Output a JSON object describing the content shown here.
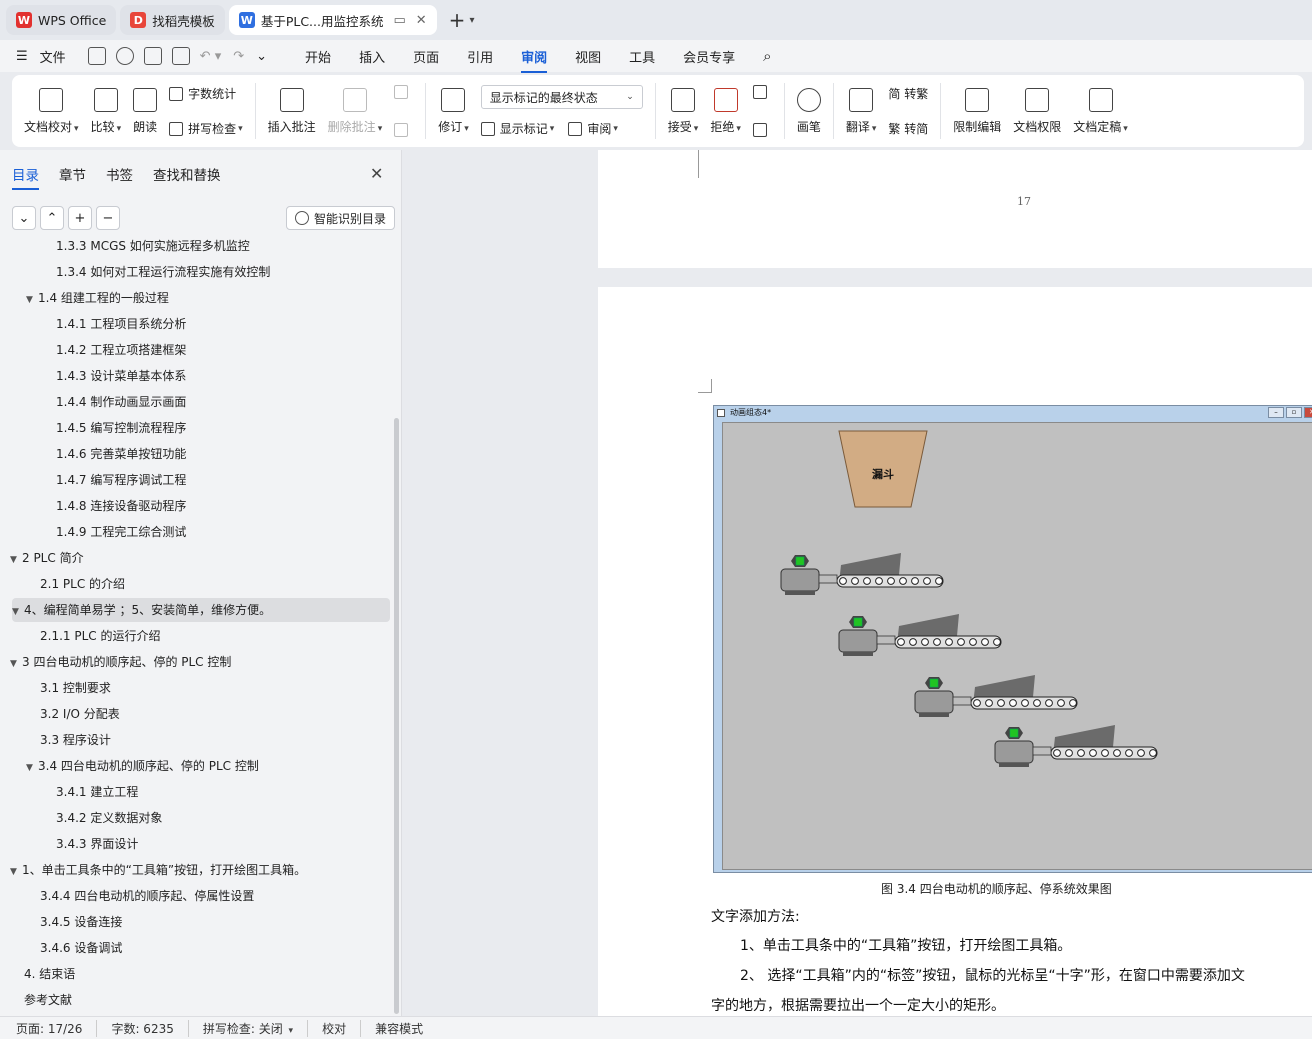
{
  "tabs": [
    {
      "label": "WPS Office",
      "state": "inactive"
    },
    {
      "label": "找稻壳模板",
      "state": "inactive"
    },
    {
      "label": "基于PLC...用监控系统",
      "state": "active"
    }
  ],
  "menubar": {
    "file_label": "文件",
    "tabs": [
      "开始",
      "插入",
      "页面",
      "引用",
      "审阅",
      "视图",
      "工具",
      "会员专享"
    ],
    "active_tab": "审阅"
  },
  "ribbon": {
    "doc_check": "文档校对",
    "compare": "比较",
    "read_aloud": "朗读",
    "word_count": "字数统计",
    "spell_check": "拼写检查",
    "insert_comment": "插入批注",
    "delete_comment": "删除批注",
    "revise": "修订",
    "markup_state": "显示标记的最终状态",
    "show_markup": "显示标记",
    "review": "审阅",
    "accept": "接受",
    "reject": "拒绝",
    "pen": "画笔",
    "translate": "翻译",
    "to_traditional": "简 转繁",
    "to_simplified": "繁 转简",
    "restrict_edit": "限制编辑",
    "doc_permission": "文档权限",
    "doc_finalize": "文档定稿"
  },
  "navpane": {
    "tabs": [
      "目录",
      "章节",
      "书签",
      "查找和替换"
    ],
    "active_tab": "目录",
    "smart_toc": "智能识别目录",
    "toc": [
      {
        "text": "1.3.3    MCGS 如何实施远程多机监控",
        "level": 3,
        "arrow": ""
      },
      {
        "text": "1.3.4    如何对工程运行流程实施有效控制",
        "level": 3,
        "arrow": ""
      },
      {
        "text": "1.4    组建工程的一般过程",
        "level": 2,
        "arrow": "▼"
      },
      {
        "text": "1.4.1    工程项目系统分析",
        "level": 3,
        "arrow": ""
      },
      {
        "text": "1.4.2    工程立项搭建框架",
        "level": 3,
        "arrow": ""
      },
      {
        "text": "1.4.3    设计菜单基本体系",
        "level": 3,
        "arrow": ""
      },
      {
        "text": "1.4.4    制作动画显示画面",
        "level": 3,
        "arrow": ""
      },
      {
        "text": "1.4.5    编写控制流程程序",
        "level": 3,
        "arrow": ""
      },
      {
        "text": "1.4.6    完善菜单按钮功能",
        "level": 3,
        "arrow": ""
      },
      {
        "text": "1.4.7    编写程序调试工程",
        "level": 3,
        "arrow": ""
      },
      {
        "text": "1.4.8    连接设备驱动程序",
        "level": 3,
        "arrow": ""
      },
      {
        "text": "1.4.9    工程完工综合测试",
        "level": 3,
        "arrow": ""
      },
      {
        "text": "2    PLC 简介",
        "level": 1,
        "arrow": "▼"
      },
      {
        "text": "2.1    PLC 的介绍",
        "level": 2,
        "arrow": ""
      },
      {
        "text": "4、编程简单易学 ；5、安装简单，维修方便。",
        "level": 1,
        "arrow": "▼",
        "highlight": true
      },
      {
        "text": "2.1.1    PLC 的运行介绍",
        "level": 2,
        "arrow": ""
      },
      {
        "text": "3    四台电动机的顺序起、停的 PLC 控制",
        "level": 1,
        "arrow": "▼"
      },
      {
        "text": "3.1    控制要求",
        "level": 2,
        "arrow": ""
      },
      {
        "text": "3.2    I/O 分配表",
        "level": 2,
        "arrow": ""
      },
      {
        "text": "3.3    程序设计",
        "level": 2,
        "arrow": ""
      },
      {
        "text": "3.4    四台电动机的顺序起、停的 PLC 控制",
        "level": 2,
        "arrow": "▼"
      },
      {
        "text": "3.4.1    建立工程",
        "level": 3,
        "arrow": ""
      },
      {
        "text": "3.4.2    定义数据对象",
        "level": 3,
        "arrow": ""
      },
      {
        "text": "3.4.3    界面设计",
        "level": 3,
        "arrow": ""
      },
      {
        "text": "1、单击工具条中的“工具箱”按钮，打开绘图工具箱。",
        "level": 1,
        "arrow": "▼"
      },
      {
        "text": "3.4.4    四台电动机的顺序起、停属性设置",
        "level": 2,
        "arrow": ""
      },
      {
        "text": "3.4.5    设备连接",
        "level": 2,
        "arrow": ""
      },
      {
        "text": "3.4.6    设备调试",
        "level": 2,
        "arrow": ""
      },
      {
        "text": "4.    结束语",
        "level": 1,
        "arrow": ""
      },
      {
        "text": "参考文献",
        "level": 1,
        "arrow": ""
      }
    ]
  },
  "document": {
    "page_number": "17",
    "embedded_window_title": "动画组态4*",
    "hopper_label": "漏斗",
    "figure_caption": "图 3.4  四台电动机的顺序起、停系统效果图",
    "para1": "文字添加方法:",
    "para2": "1、单击工具条中的“工具箱”按钮，打开绘图工具箱。",
    "para3": "2、 选择“工具箱”内的“标签”按钮，鼠标的光标呈“十字”形，在窗口中需要添加文",
    "para4": "字的地方，根据需要拉出一个一定大小的矩形。"
  },
  "statusbar": {
    "page": "页面: 17/26",
    "words": "字数: 6235",
    "spell": "拼写检查: 关闭",
    "proof": "校对",
    "compat": "兼容模式"
  },
  "colors": {
    "accent": "#1a5fd6",
    "wps_red": "#e2312f",
    "docer_red": "#e8463a",
    "writer_blue": "#2f6fe0",
    "hopper_fill": "#d2ac84",
    "motor_indicator": "#22c322"
  }
}
